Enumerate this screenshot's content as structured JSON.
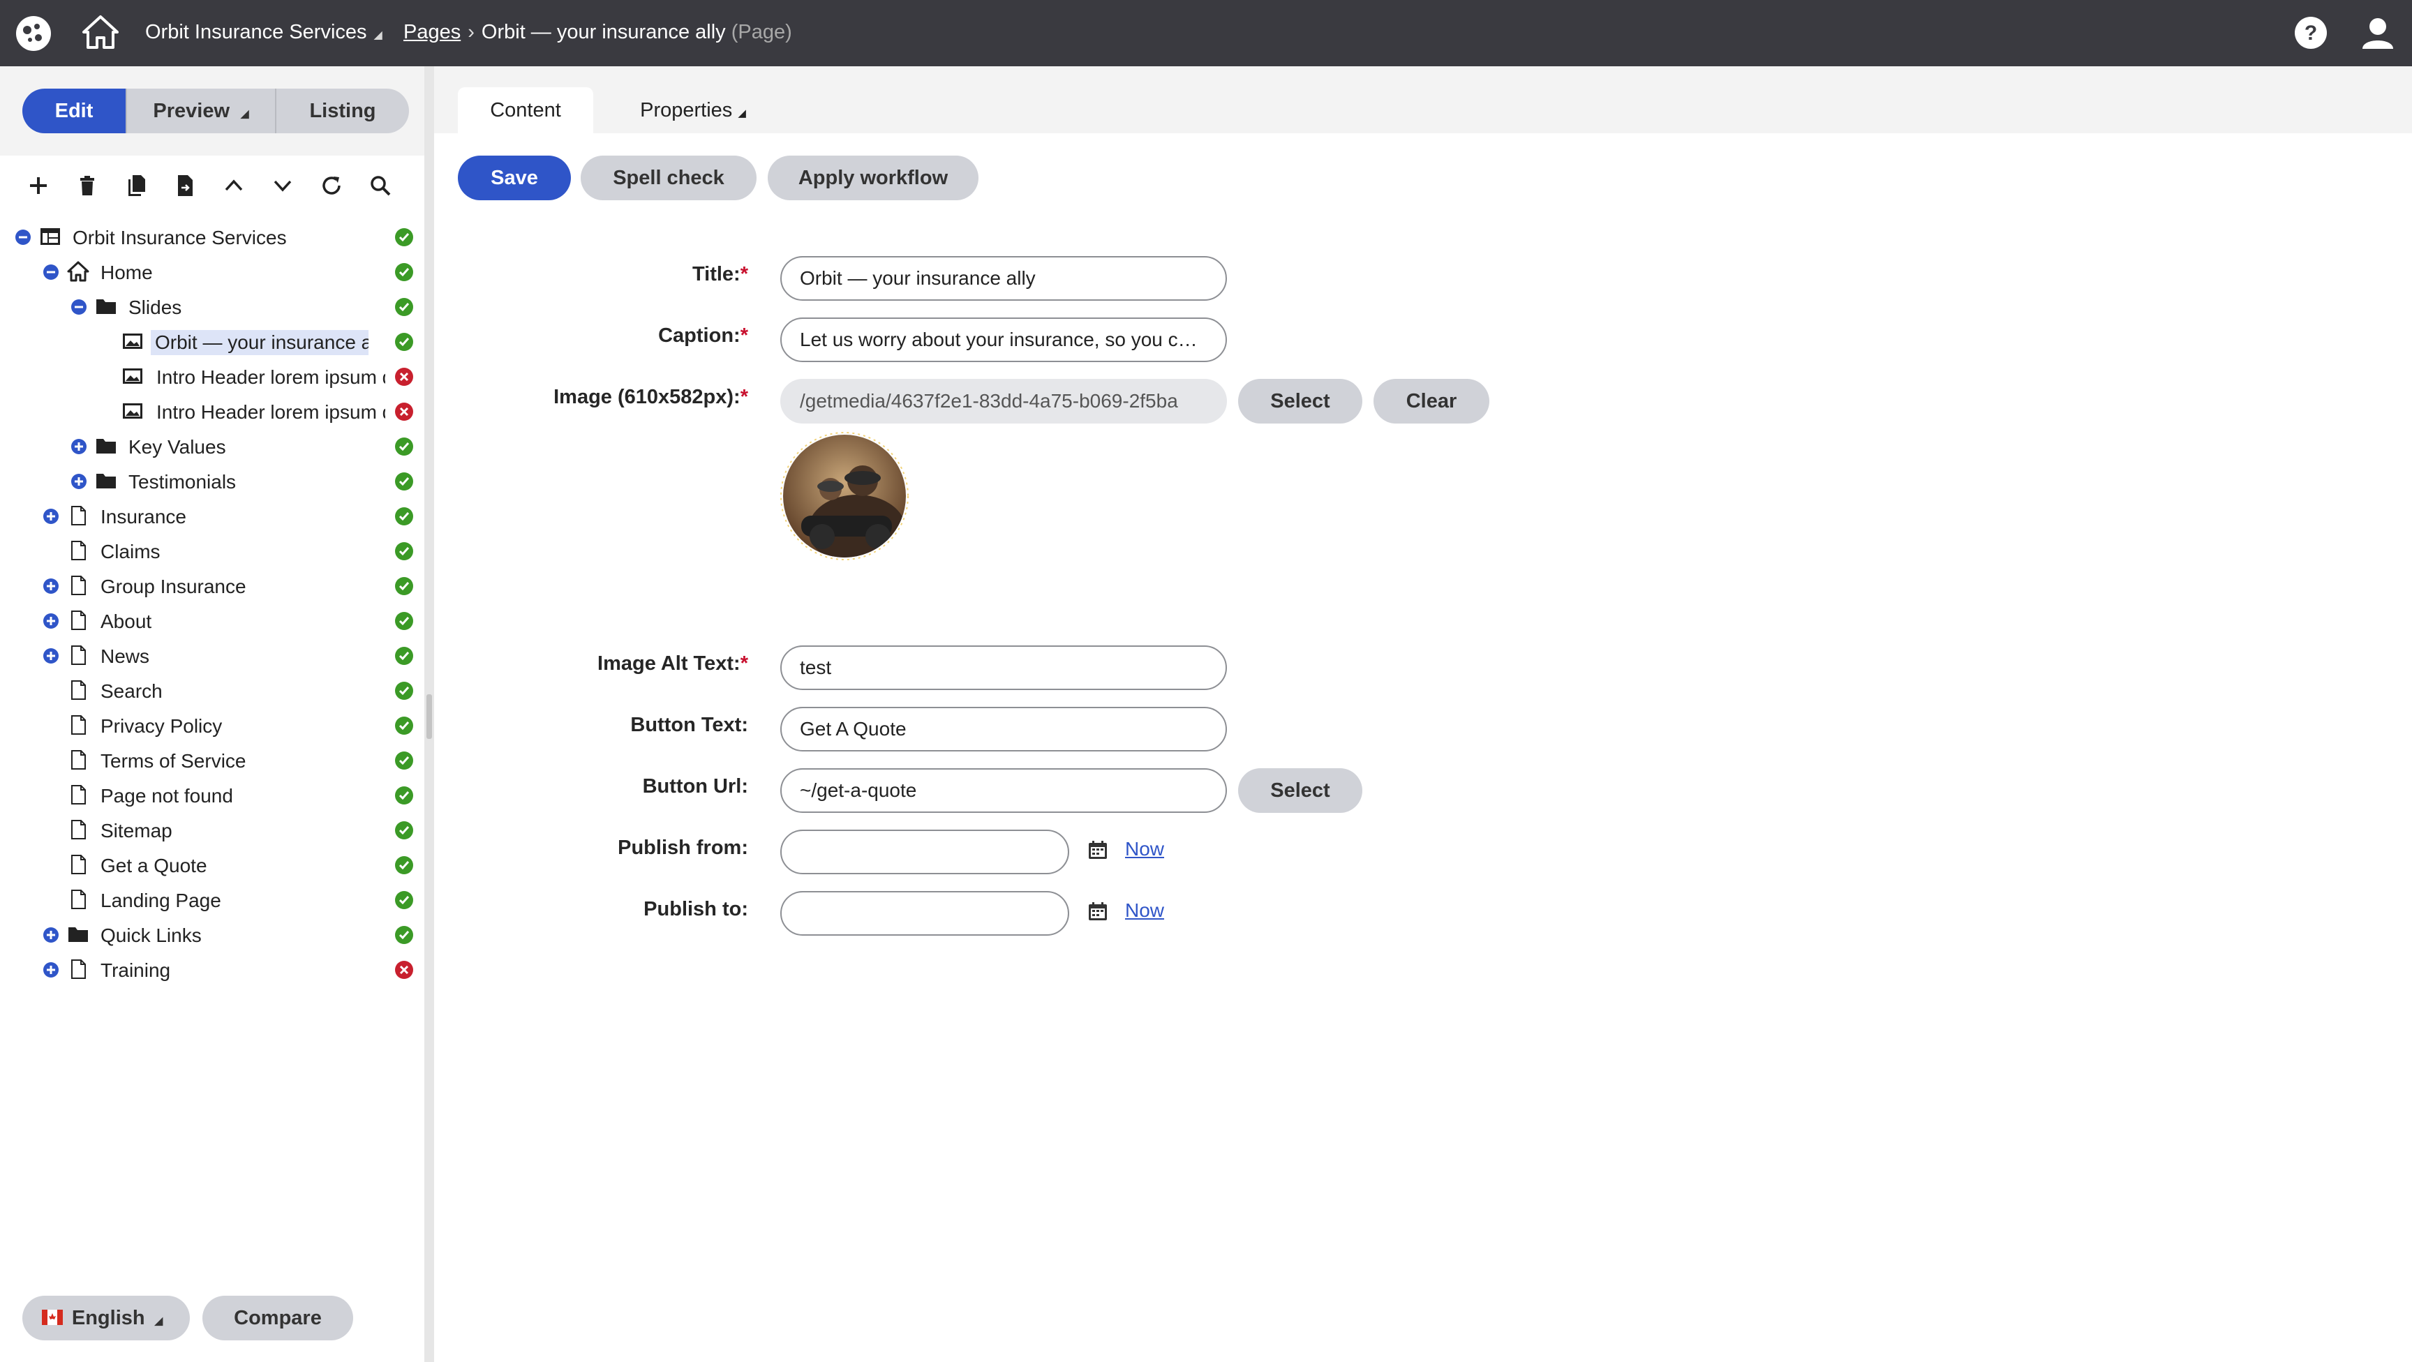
{
  "topbar": {
    "site_name": "Orbit Insurance Services",
    "breadcrumb_link": "Pages",
    "breadcrumb_current": "Orbit — your insurance ally",
    "breadcrumb_type": "(Page)",
    "icons": [
      "kentico-logo-icon",
      "home-icon",
      "help-icon",
      "user-icon"
    ]
  },
  "modes": {
    "edit": "Edit",
    "preview": "Preview",
    "listing": "Listing"
  },
  "tree": [
    {
      "label": "Orbit Insurance Services",
      "status": "ok"
    },
    {
      "label": "Home",
      "status": "ok"
    },
    {
      "label": "Slides",
      "status": "ok"
    },
    {
      "label": "Orbit — your insurance ally",
      "status": "ok",
      "selected": true
    },
    {
      "label": "Intro Header lorem ipsum d",
      "status": "error"
    },
    {
      "label": "Intro Header lorem ipsum d",
      "status": "error"
    },
    {
      "label": "Key Values",
      "status": "ok"
    },
    {
      "label": "Testimonials",
      "status": "ok"
    },
    {
      "label": "Insurance",
      "status": "ok"
    },
    {
      "label": "Claims",
      "status": "ok"
    },
    {
      "label": "Group Insurance",
      "status": "ok"
    },
    {
      "label": "About",
      "status": "ok"
    },
    {
      "label": "News",
      "status": "ok"
    },
    {
      "label": "Search",
      "status": "ok"
    },
    {
      "label": "Privacy Policy",
      "status": "ok"
    },
    {
      "label": "Terms of Service",
      "status": "ok"
    },
    {
      "label": "Page not found",
      "status": "ok"
    },
    {
      "label": "Sitemap",
      "status": "ok"
    },
    {
      "label": "Get a Quote",
      "status": "ok"
    },
    {
      "label": "Landing Page",
      "status": "ok"
    },
    {
      "label": "Quick Links",
      "status": "ok"
    },
    {
      "label": "Training",
      "status": "error"
    }
  ],
  "bottom": {
    "language": "English",
    "compare": "Compare"
  },
  "tabs": {
    "content": "Content",
    "properties": "Properties"
  },
  "actions": {
    "save": "Save",
    "spell_check": "Spell check",
    "apply_workflow": "Apply workflow"
  },
  "form": {
    "title_label": "Title:",
    "title_value": "Orbit — your insurance ally",
    "caption_label": "Caption:",
    "caption_value": "Let us worry about your insurance, so you can focus on what matters",
    "image_label": "Image (610x582px):",
    "image_value": "/getmedia/4637f2e1-83dd-4a75-b069-2f5ba",
    "image_select": "Select",
    "image_clear": "Clear",
    "alt_label": "Image Alt Text:",
    "alt_value": "test",
    "button_text_label": "Button Text:",
    "button_text_value": "Get A Quote",
    "button_url_label": "Button Url:",
    "button_url_value": "~/get-a-quote",
    "button_url_select": "Select",
    "publish_from_label": "Publish from:",
    "publish_from_value": "",
    "publish_from_now": "Now",
    "publish_to_label": "Publish to:",
    "publish_to_value": "",
    "publish_to_now": "Now",
    "required_mark": "*"
  },
  "colors": {
    "primary": "#2f55c8",
    "topbar": "#3a3a40",
    "ok": "#3b9a26",
    "error": "#c8202e",
    "secondary_button": "#d0d2d8"
  }
}
